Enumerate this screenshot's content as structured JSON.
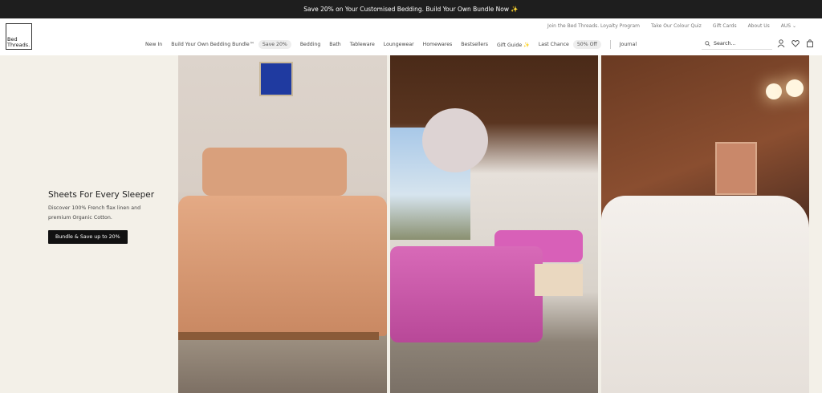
{
  "promo": {
    "text": "Save 20% on Your Customised Bedding. Build Your Own Bundle Now ✨"
  },
  "logo": {
    "line1": "Bed",
    "line2": "Threads."
  },
  "utility_links": [
    "Join the Bed Threads. Loyalty Program",
    "Take Our Colour Quiz",
    "Gift Cards",
    "About Us",
    "AUS ⌄"
  ],
  "nav": {
    "items": [
      "New In",
      "Build Your Own Bedding Bundle™",
      "Bedding",
      "Bath",
      "Tableware",
      "Loungewear",
      "Homewares",
      "Bestsellers",
      "Gift Guide ✨",
      "Last Chance",
      "Journal"
    ],
    "badge_bundle": "Save 20%",
    "badge_last_chance": "50% Off"
  },
  "search": {
    "placeholder": "Search..."
  },
  "header_icons": [
    "user-icon",
    "heart-icon",
    "bag-icon"
  ],
  "hero": {
    "title": "Sheets For Every Sleeper",
    "description": "Discover 100% French flax linen and premium Organic Cotton.",
    "button": "Bundle & Save up to 20%"
  },
  "colors": {
    "promo_bg": "#1e1e1e",
    "hero_bg": "#f3f0e8",
    "button_bg": "#111111"
  }
}
